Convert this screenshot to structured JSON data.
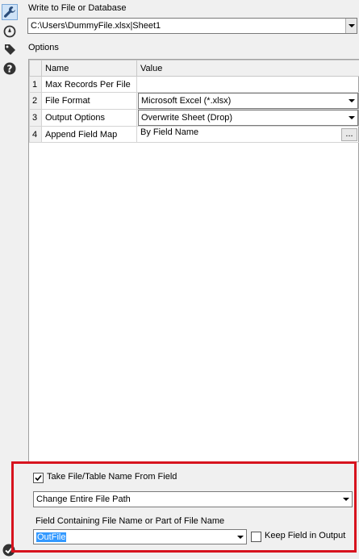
{
  "sidebar": {
    "icons": [
      "wrench-icon",
      "navigate-icon",
      "tag-icon",
      "help-icon"
    ],
    "status_icon": "checkmark-icon"
  },
  "output": {
    "label": "Write to File or Database",
    "value": "C:\\Users\\DummyFile.xlsx|Sheet1"
  },
  "options": {
    "label": "Options",
    "columns": [
      "Name",
      "Value"
    ],
    "rows": [
      {
        "num": "1",
        "name": "Max Records Per File",
        "value": ""
      },
      {
        "num": "2",
        "name": "File Format",
        "value": "Microsoft Excel (*.xlsx)"
      },
      {
        "num": "3",
        "name": "Output Options",
        "value": "Overwrite Sheet (Drop)"
      },
      {
        "num": "4",
        "name": "Append Field Map",
        "value": "By Field Name",
        "button": "..."
      }
    ]
  },
  "file_name_section": {
    "take_from_field_label": "Take File/Table Name From Field",
    "take_from_field_checked": true,
    "mode_value": "Change Entire File Path",
    "field_label": "Field Containing File Name or Part of File Name",
    "field_value": "OutFile",
    "keep_field_label": "Keep Field in Output",
    "keep_field_checked": false
  },
  "colors": {
    "highlight_border": "#d7131e",
    "selection": "#3399ff"
  }
}
